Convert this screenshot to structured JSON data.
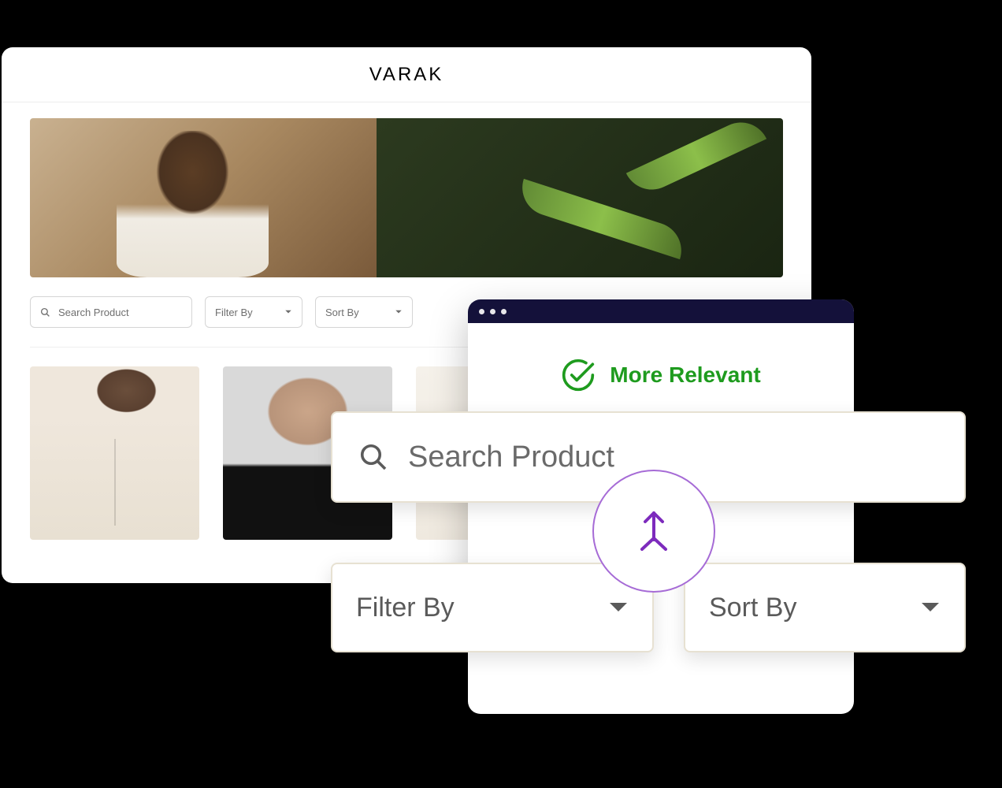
{
  "site": {
    "brand": "VARAK",
    "search_placeholder": "Search Product",
    "filter_label": "Filter By",
    "sort_label": "Sort By"
  },
  "popup": {
    "status_label": "More Relevant",
    "search_placeholder": "Search Product",
    "filter_label": "Filter By",
    "sort_label": "Sort By"
  }
}
